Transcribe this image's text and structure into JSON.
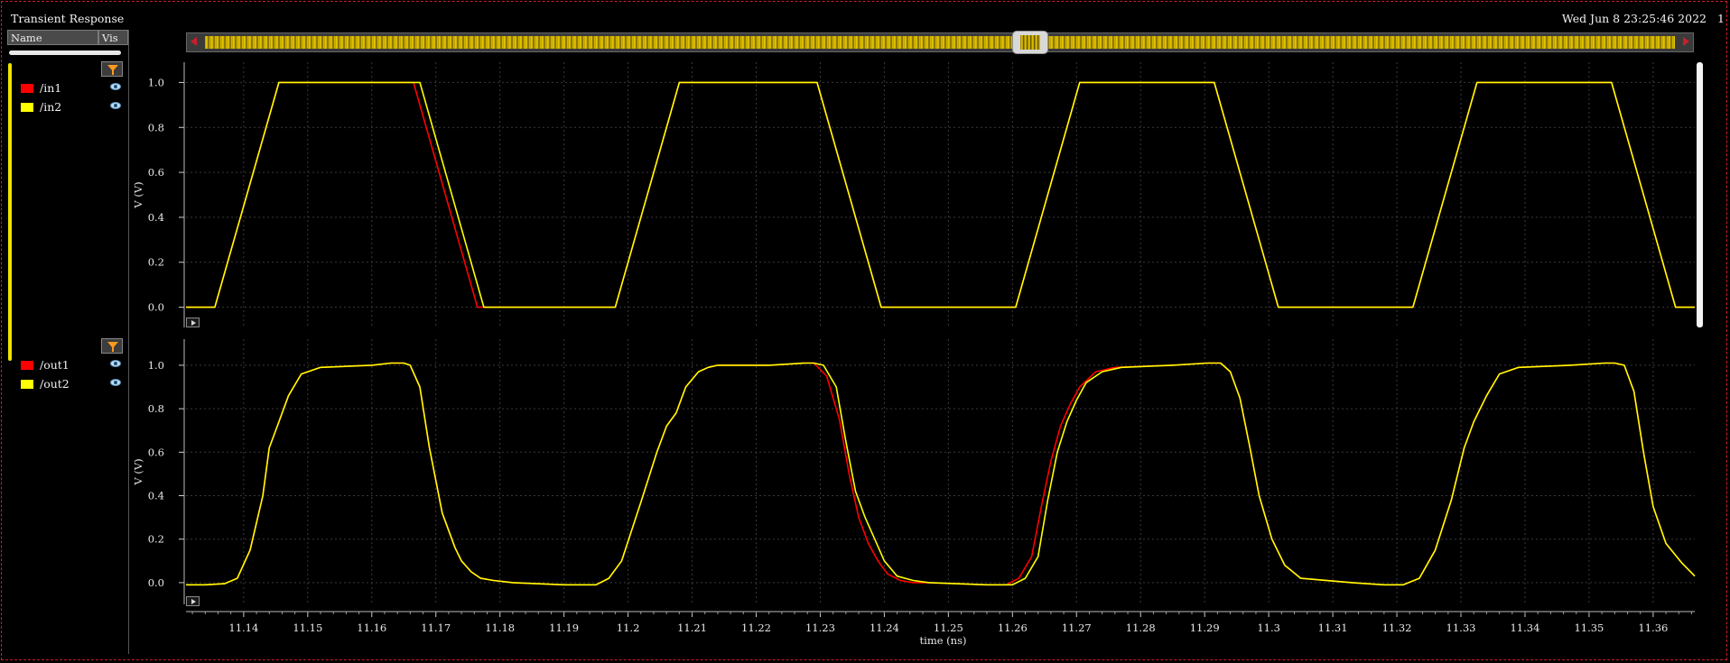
{
  "window": {
    "title": "Transient Response",
    "datetime": "Wed Jun 8 23:25:46 2022",
    "index": "1"
  },
  "browser": {
    "col_name": "Name",
    "col_vis": "Vis",
    "groups": [
      {
        "signals": [
          {
            "name": "/in1",
            "color": "#ff0000"
          },
          {
            "name": "/in2",
            "color": "#ffff00"
          }
        ]
      },
      {
        "signals": [
          {
            "name": "/out1",
            "color": "#ff0000"
          },
          {
            "name": "/out2",
            "color": "#ffff00"
          }
        ]
      }
    ]
  },
  "chart_data": {
    "type": "line",
    "xlabel": "time (ns)",
    "xlim": [
      11.131,
      11.3665
    ],
    "xticks": [
      "11.14",
      "11.15",
      "11.16",
      "11.17",
      "11.18",
      "11.19",
      "11.2",
      "11.21",
      "11.22",
      "11.23",
      "11.24",
      "11.25",
      "11.26",
      "11.27",
      "11.28",
      "11.29",
      "11.3",
      "11.31",
      "11.32",
      "11.33",
      "11.34",
      "11.35",
      "11.36"
    ],
    "grid": true,
    "panels": [
      {
        "ylabel": "V (V)",
        "ylim": [
          -0.09,
          1.09
        ],
        "yticks": [
          "0.0",
          "0.2",
          "0.4",
          "0.6",
          "0.8",
          "1.0"
        ],
        "series": [
          {
            "name": "/in1",
            "color": "#ff0000",
            "x": [
              11.131,
              11.1355,
              11.1455,
              11.1665,
              11.1765,
              11.1775,
              11.198,
              11.208,
              11.2295,
              11.2395,
              11.2605,
              11.2705,
              11.2915,
              11.3015,
              11.3225,
              11.3325,
              11.3535,
              11.3635,
              11.3665
            ],
            "y": [
              0,
              0,
              1,
              1,
              0,
              0,
              0,
              1,
              1,
              0,
              0,
              1,
              1,
              0,
              0,
              1,
              1,
              0,
              0
            ]
          },
          {
            "name": "/in2",
            "color": "#ffff00",
            "x": [
              11.131,
              11.1355,
              11.1455,
              11.1665,
              11.1675,
              11.1775,
              11.198,
              11.208,
              11.2295,
              11.2395,
              11.2605,
              11.2705,
              11.2915,
              11.3015,
              11.3225,
              11.3325,
              11.3535,
              11.3635,
              11.3665
            ],
            "y": [
              0,
              0,
              1,
              1,
              1,
              0,
              0,
              1,
              1,
              0,
              0,
              1,
              1,
              0,
              0,
              1,
              1,
              0,
              0
            ]
          }
        ]
      },
      {
        "ylabel": "V (V)",
        "ylim": [
          -0.1,
          1.12
        ],
        "yticks": [
          "0.0",
          "0.2",
          "0.4",
          "0.6",
          "0.8",
          "1.0"
        ],
        "series": [
          {
            "name": "/out1",
            "color": "#ff0000",
            "x": [
              11.131,
              11.134,
              11.137,
              11.139,
              11.141,
              11.143,
              11.144,
              11.1455,
              11.147,
              11.149,
              11.152,
              11.16,
              11.163,
              11.165,
              11.166,
              11.1675,
              11.169,
              11.171,
              11.173,
              11.174,
              11.1755,
              11.177,
              11.179,
              11.182,
              11.19,
              11.195,
              11.197,
              11.199,
              11.202,
              11.2045,
              11.206,
              11.2075,
              11.209,
              11.211,
              11.2125,
              11.214,
              11.222,
              11.2275,
              11.229,
              11.231,
              11.233,
              11.2345,
              11.236,
              11.2375,
              11.239,
              11.2405,
              11.2425,
              11.2445,
              11.247,
              11.256,
              11.259,
              11.261,
              11.263,
              11.2645,
              11.266,
              11.2675,
              11.269,
              11.2705,
              11.273,
              11.276,
              11.285,
              11.2905,
              11.2925,
              11.294,
              11.2955,
              11.297,
              11.2985,
              11.3005,
              11.3025,
              11.305,
              11.313,
              11.318,
              11.321,
              11.3235,
              11.326,
              11.3285,
              11.3305,
              11.332,
              11.334,
              11.336,
              11.339,
              11.347,
              11.3525,
              11.354,
              11.3555,
              11.357,
              11.3585,
              11.36,
              11.362,
              11.3645,
              11.3665
            ],
            "y": [
              -0.01,
              -0.01,
              -0.005,
              0.02,
              0.15,
              0.4,
              0.62,
              0.74,
              0.86,
              0.96,
              0.99,
              1.0,
              1.01,
              1.01,
              1.0,
              0.9,
              0.62,
              0.32,
              0.16,
              0.1,
              0.05,
              0.02,
              0.01,
              0.0,
              -0.01,
              -0.01,
              0.02,
              0.1,
              0.37,
              0.6,
              0.72,
              0.78,
              0.9,
              0.97,
              0.99,
              1.0,
              1.0,
              1.01,
              1.01,
              0.95,
              0.75,
              0.5,
              0.3,
              0.18,
              0.1,
              0.04,
              0.01,
              0.0,
              0.0,
              -0.01,
              -0.01,
              0.02,
              0.12,
              0.35,
              0.56,
              0.72,
              0.82,
              0.9,
              0.97,
              0.99,
              1.0,
              1.01,
              1.01,
              0.97,
              0.85,
              0.63,
              0.4,
              0.2,
              0.08,
              0.02,
              0.0,
              -0.01,
              -0.01,
              0.02,
              0.15,
              0.38,
              0.62,
              0.74,
              0.86,
              0.96,
              0.99,
              1.0,
              1.01,
              1.01,
              1.0,
              0.88,
              0.6,
              0.35,
              0.18,
              0.09,
              0.03
            ]
          },
          {
            "name": "/out2",
            "color": "#ffff00",
            "x": [
              11.131,
              11.134,
              11.137,
              11.139,
              11.141,
              11.143,
              11.144,
              11.1455,
              11.147,
              11.149,
              11.152,
              11.16,
              11.163,
              11.165,
              11.166,
              11.1675,
              11.169,
              11.171,
              11.173,
              11.174,
              11.1755,
              11.177,
              11.179,
              11.182,
              11.19,
              11.195,
              11.197,
              11.199,
              11.202,
              11.2045,
              11.206,
              11.2075,
              11.209,
              11.211,
              11.2125,
              11.214,
              11.222,
              11.2275,
              11.229,
              11.2305,
              11.2325,
              11.234,
              11.2355,
              11.237,
              11.2385,
              11.24,
              11.242,
              11.2445,
              11.247,
              11.256,
              11.26,
              11.262,
              11.264,
              11.2655,
              11.267,
              11.2685,
              11.27,
              11.2715,
              11.274,
              11.277,
              11.285,
              11.2905,
              11.2925,
              11.294,
              11.2955,
              11.297,
              11.2985,
              11.3005,
              11.3025,
              11.305,
              11.313,
              11.318,
              11.321,
              11.3235,
              11.326,
              11.3285,
              11.3305,
              11.332,
              11.334,
              11.336,
              11.339,
              11.347,
              11.3525,
              11.354,
              11.3555,
              11.357,
              11.3585,
              11.36,
              11.362,
              11.3645,
              11.3665
            ],
            "y": [
              -0.01,
              -0.01,
              -0.005,
              0.02,
              0.15,
              0.4,
              0.62,
              0.74,
              0.86,
              0.96,
              0.99,
              1.0,
              1.01,
              1.01,
              1.0,
              0.9,
              0.62,
              0.32,
              0.16,
              0.1,
              0.05,
              0.02,
              0.01,
              0.0,
              -0.01,
              -0.01,
              0.02,
              0.1,
              0.37,
              0.6,
              0.72,
              0.78,
              0.9,
              0.97,
              0.99,
              1.0,
              1.0,
              1.01,
              1.01,
              1.0,
              0.9,
              0.65,
              0.42,
              0.3,
              0.2,
              0.1,
              0.03,
              0.01,
              0.0,
              -0.01,
              -0.01,
              0.02,
              0.12,
              0.38,
              0.6,
              0.74,
              0.84,
              0.92,
              0.97,
              0.99,
              1.0,
              1.01,
              1.01,
              0.97,
              0.85,
              0.63,
              0.4,
              0.2,
              0.08,
              0.02,
              0.0,
              -0.01,
              -0.01,
              0.02,
              0.15,
              0.38,
              0.62,
              0.74,
              0.86,
              0.96,
              0.99,
              1.0,
              1.01,
              1.01,
              1.0,
              0.88,
              0.6,
              0.35,
              0.18,
              0.09,
              0.03
            ]
          }
        ]
      }
    ]
  }
}
